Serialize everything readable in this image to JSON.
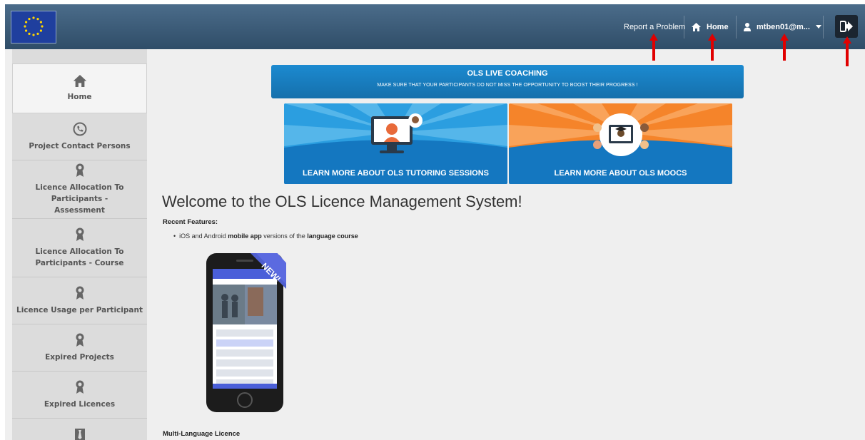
{
  "header": {
    "report_label": "Report a Problem",
    "home_label": "Home",
    "user_label": "mtben01@m...",
    "colors": {
      "bar": "#3a5a78",
      "logout_bg": "#1b2530",
      "annotation_arrow": "#e00000"
    }
  },
  "sidebar": {
    "items": [
      {
        "label": "Home",
        "icon": "home-icon"
      },
      {
        "label": "Project Contact Persons",
        "icon": "phone-icon"
      },
      {
        "label": "Licence Allocation To Participants - Assessment",
        "icon": "award-icon"
      },
      {
        "label": "Licence Allocation To Participants - Course",
        "icon": "award-icon"
      },
      {
        "label": "Licence Usage per Participant",
        "icon": "award-icon"
      },
      {
        "label": "Expired Projects",
        "icon": "award-icon"
      },
      {
        "label": "Expired Licences",
        "icon": "award-icon"
      },
      {
        "label": "",
        "icon": "tie-icon"
      }
    ]
  },
  "banner": {
    "title": "OLS LIVE COACHING",
    "subtitle": "MAKE SURE THAT YOUR PARTICIPANTS DO NOT MISS THE OPPORTUNITY TO BOOST THEIR PROGRESS !",
    "color": "#1b7fc1"
  },
  "promos": [
    {
      "label": "LEARN MORE ABOUT OLS TUTORING SESSIONS",
      "color": "#2b9ee0"
    },
    {
      "label": "LEARN MORE ABOUT OLS MOOCS",
      "color": "#f5842a"
    }
  ],
  "main": {
    "welcome": "Welcome to the OLS Licence Management System!",
    "recent_heading": "Recent Features:",
    "bullet": {
      "part1": "iOS and Android ",
      "bold1": "mobile app",
      "part2": " versions of the ",
      "bold2": "language course"
    },
    "phone_ribbon": "NEW!",
    "multi_heading": "Multi-Language Licence"
  }
}
